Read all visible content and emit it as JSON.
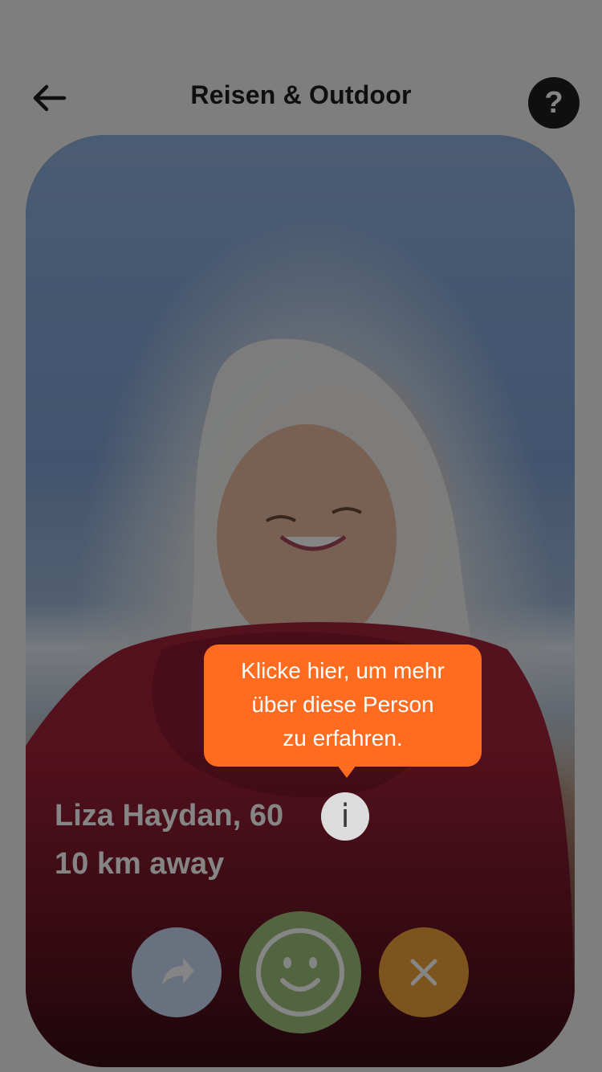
{
  "header": {
    "title": "Reisen & Outdoor",
    "back_icon": "arrow-left-icon",
    "help_label": "?"
  },
  "profile": {
    "name_age": "Liza Haydan, 60",
    "distance": "10 km away",
    "info_label": "i"
  },
  "actions": {
    "share_icon": "share-arrow-icon",
    "like_icon": "smiley-icon",
    "dismiss_icon": "close-icon"
  },
  "tooltip": {
    "lines": [
      "Klicke hier, um mehr",
      "über diese Person",
      "zu erfahren."
    ]
  },
  "colors": {
    "accent": "#ff6b1f",
    "like": "#9fc27b",
    "dismiss": "#f2a23a",
    "share": "#c9d9f2",
    "dark": "#1e1e1e"
  }
}
